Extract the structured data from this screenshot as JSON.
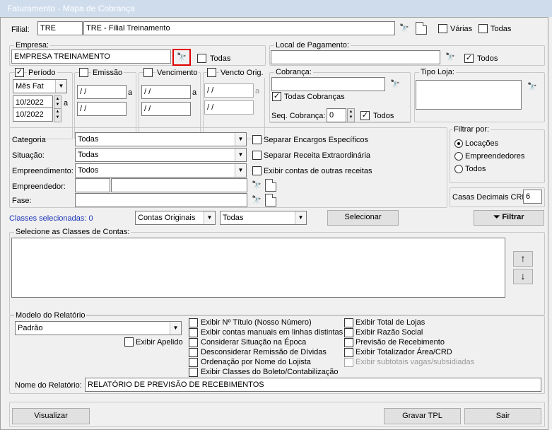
{
  "window": {
    "title": "Faturamento - Mapa de Cobrança"
  },
  "filial": {
    "label": "Filial:",
    "code": "TRE",
    "name": "TRE - Filial Treinamento",
    "varias": "Várias",
    "todas": "Todas"
  },
  "empresa": {
    "title": "Empresa:",
    "value": "EMPRESA TREINAMENTO",
    "todas": "Todas"
  },
  "local_pagamento": {
    "title": "Local de Pagamento:",
    "todos": "Todos"
  },
  "periodo": {
    "title": "Período",
    "mode": "Mês Fat",
    "from": "10/2022",
    "to": "10/2022",
    "sep": "a"
  },
  "emissao": {
    "title": "Emissão",
    "from": " / /",
    "to": " / /",
    "sep": "a"
  },
  "vencimento": {
    "title": "Vencimento",
    "from": " / /",
    "to": " / /",
    "sep": "a"
  },
  "vencto_orig": {
    "title": "Vencto Orig.",
    "from": " / /",
    "to": " / /",
    "sep": "a"
  },
  "cobranca": {
    "title": "Cobrança:",
    "todas": "Todas Cobranças",
    "seq_label": "Seq. Cobrança:",
    "seq_value": "0",
    "todos": "Todos"
  },
  "tipo_loja": {
    "title": "Tipo Loja:"
  },
  "filters": {
    "categoria": {
      "label": "Categoria",
      "value": "Todas"
    },
    "situacao": {
      "label": "Situação:",
      "value": "Todas"
    },
    "empreendimento": {
      "label": "Empreendimento:",
      "value": "Todos"
    },
    "empreendedor": {
      "label": "Empreendedor:"
    },
    "fase": {
      "label": "Fase:"
    }
  },
  "options": {
    "separar_encargos": "Separar Encargos Específicos",
    "separar_receita": "Separar Receita Extraordinária",
    "exibir_outras": "Exibir contas de outras receitas"
  },
  "filtrar_por": {
    "title": "Filtrar por:",
    "options": [
      "Locações",
      "Empreendedores",
      "Todos"
    ],
    "selected": "Locações"
  },
  "casas_decimais": {
    "label": "Casas Decimais CRD",
    "value": "6"
  },
  "classes": {
    "selected_label": "Classes selecionadas: 0",
    "contas": "Contas Originais",
    "todas": "Todas",
    "selecionar": "Selecionar",
    "filtrar": "Filtrar",
    "list_title": "Selecione as Classes de Contas:"
  },
  "modelo": {
    "title": "Modelo do Relatório",
    "value": "Padrão",
    "exibir_apelido": "Exibir Apelido",
    "nome_label": "Nome do Relatório:",
    "nome_value": "RELATÓRIO DE PREVISÃO DE RECEBIMENTOS"
  },
  "report_options_left": [
    "Exibir Nº Título (Nosso Número)",
    "Exibir contas manuais em linhas distintas",
    "Considerar Situação na Época",
    "Desconsiderar Remissão de Dívidas",
    "Ordenação por Nome do Lojista",
    "Exibir Classes do Boleto/Contabilização"
  ],
  "report_options_right": [
    "Exibir Total de Lojas",
    "Exibir Razão Social",
    "Previsão de Recebimento",
    "Exibir Totalizador Área/CRD",
    "Exibir subtotais vagas/subsidiadas"
  ],
  "footer": {
    "visualizar": "Visualizar",
    "gravar": "Gravar TPL",
    "sair": "Sair"
  },
  "colors": {
    "titlebar": "#cfdcec",
    "highlight": "#e00000",
    "link_blue": "#1a33b8"
  }
}
